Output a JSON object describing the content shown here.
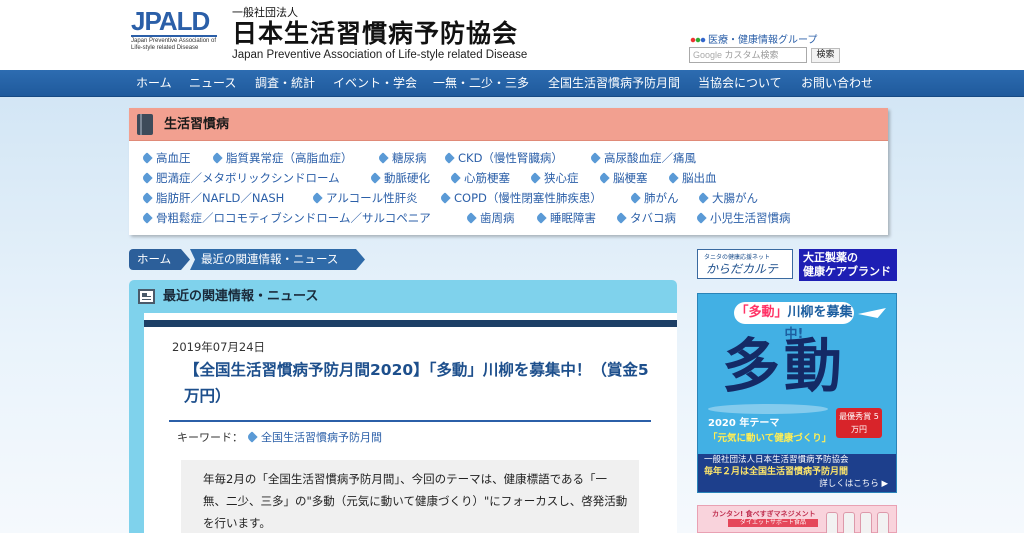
{
  "header": {
    "logo_text": "JPALD",
    "logo_sub": "Japan Preventive Association of Life-style related Disease",
    "org_prefix": "一般社団法人",
    "org_name": "日本生活習慣病予防協会",
    "org_name_en": "Japan Preventive Association of Life-style related Disease",
    "group_link": "医療・健康情報グループ",
    "search_google": "Google",
    "search_placeholder": "カスタム検索",
    "search_button": "検索"
  },
  "nav": [
    "ホーム",
    "ニュース",
    "調査・統計",
    "イベント・学会",
    "一無・二少・三多",
    "全国生活習慣病予防月間",
    "当協会について",
    "お問い合わせ"
  ],
  "categories": {
    "title": "生活習慣病",
    "rows": [
      [
        "高血圧",
        "脂質異常症（高脂血症）",
        "糖尿病",
        "CKD（慢性腎臓病）",
        "高尿酸血症／痛風"
      ],
      [
        "肥満症／メタボリックシンドローム",
        "動脈硬化",
        "心筋梗塞",
        "狭心症",
        "脳梗塞",
        "脳出血"
      ],
      [
        "脂肪肝／NAFLD／NASH",
        "アルコール性肝炎",
        "COPD（慢性閉塞性肺疾患）",
        "肺がん",
        "大腸がん"
      ],
      [
        "骨粗鬆症／ロコモティブシンドローム／サルコペニア",
        "歯周病",
        "睡眠障害",
        "タバコ病",
        "小児生活習慣病"
      ]
    ]
  },
  "breadcrumb": [
    "ホーム",
    "最近の関連情報・ニュース"
  ],
  "news": {
    "section_title": "最近の関連情報・ニュース",
    "date": "2019年07月24日",
    "title": "【全国生活習慣病予防月間2020】「多動」川柳を募集中！（賞金5万円）",
    "keyword_label": "キーワード：",
    "keyword": "全国生活習慣病予防月間",
    "summary": "年毎2月の「全国生活習慣病予防月間」、今回のテーマは、健康標語である「一無、二少、三多」の\"多動（元気に動いて健康づくり）\"にフォーカスし、啓発活動を行います。"
  },
  "sidebar": {
    "banner1_small": "タニタの健康応援ネット",
    "banner1_main": "からだカルテ",
    "banner2_line1": "大正製薬の",
    "banner2_line2": "健康ケアブランド",
    "poster_badge_a": "「多動」",
    "poster_badge_b": "川柳を募集中!",
    "poster_big": "多動",
    "poster_ribbon": "最優秀賞 5万円",
    "poster_theme": "2020 年テーマ",
    "poster_theme_sub": "「元気に動いて健康づくり」",
    "poster_foot1": "一般社団法人日本生活習慣病予防協会",
    "poster_foot2": "毎年２月は全国生活習慣病予防月間",
    "poster_foot3": "詳しくはこちら ▶",
    "banner3_small": "カンタン! 食べすぎマネジメント",
    "banner3_bar": "ダイエットサポート食品"
  },
  "colors": {
    "nav_blue": "#2d6cb1",
    "category_header": "#f2a090",
    "news_header": "#7fd2ec",
    "link_blue": "#2b5fa8",
    "poster_blue": "#42b0e4"
  }
}
